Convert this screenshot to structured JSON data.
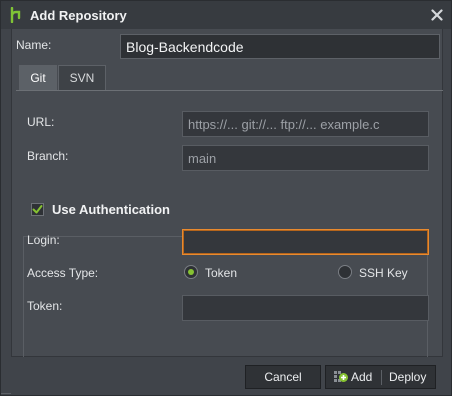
{
  "window": {
    "title": "Add Repository",
    "app_icon": "branch-icon",
    "close_icon": "close-icon"
  },
  "form": {
    "name_label": "Name:",
    "name_value": "Blog-Backendcode",
    "tabs": [
      {
        "label": "Git",
        "active": true
      },
      {
        "label": "SVN",
        "active": false
      }
    ],
    "url_label": "URL:",
    "url_placeholder": "https://... git://... ftp://... example.c",
    "branch_label": "Branch:",
    "branch_placeholder": "main"
  },
  "auth": {
    "label": "Use Authentication",
    "checked": true,
    "login_label": "Login:",
    "login_value": "",
    "access_type_label": "Access Type:",
    "options": [
      {
        "label": "Token",
        "selected": true
      },
      {
        "label": "SSH Key",
        "selected": false
      }
    ],
    "token_label": "Token:",
    "token_value": ""
  },
  "footer": {
    "cancel_label": "Cancel",
    "add_label": "Add",
    "deploy_label": "Deploy",
    "add_icon": "add-icon"
  },
  "colors": {
    "accent_check": "#86c232",
    "focus_border": "#e88a2f",
    "background": "#40444a"
  }
}
